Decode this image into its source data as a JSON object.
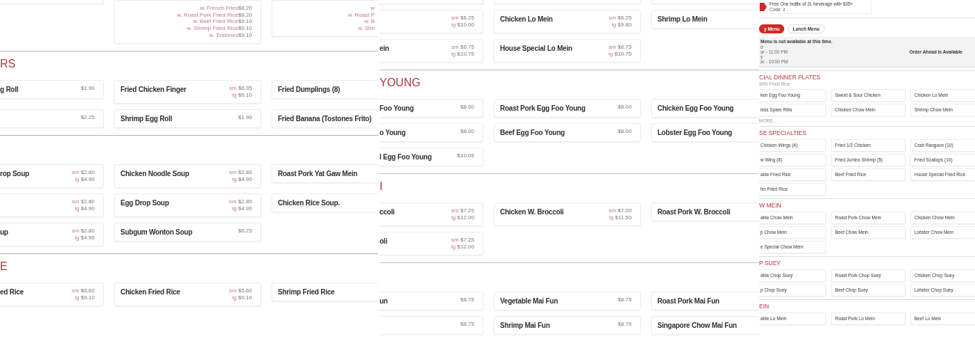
{
  "panels": [
    {
      "sections": [
        {
          "rows": [
            [
              {},
              {
                "options": [
                  {
                    "label": "w. French Fries",
                    "amount": "$8.20"
                  },
                  {
                    "label": "w. Roast Pork Fried Rice",
                    "amount": "$8.20"
                  },
                  {
                    "label": "w. Beef Fried Rice",
                    "amount": "$9.10"
                  },
                  {
                    "label": "w. Shrimp Fried Rice",
                    "amount": "$9.10"
                  },
                  {
                    "label": "w. Tostones",
                    "amount": "$9.10"
                  }
                ]
              },
              {
                "options": [
                  {
                    "label": "w"
                  },
                  {
                    "label": "w. Roast P"
                  },
                  {
                    "label": "w. B"
                  },
                  {
                    "label": "w. Shri"
                  }
                ]
              }
            ]
          ]
        },
        {
          "heading": "RS",
          "rows": [
            [
              {
                "name": "g Roll",
                "price": "$1.90"
              },
              {
                "name": "Fried Chicken Finger",
                "prices": [
                  {
                    "size": "sm",
                    "amount": "$6.35"
                  },
                  {
                    "size": "lg",
                    "amount": "$9.10"
                  }
                ]
              },
              {
                "name": "Fried Dumplings (8)"
              }
            ],
            [
              {
                "price": "$2.25"
              },
              {
                "name": "Shrimp Egg Roll",
                "price": "$1.90"
              },
              {
                "name": "Fried Banana (Tostones Frito)"
              }
            ]
          ]
        },
        {
          "rows": [
            [
              {
                "name": "rop Soup",
                "prices": [
                  {
                    "size": "sm",
                    "amount": "$2.80"
                  },
                  {
                    "size": "lg",
                    "amount": "$4.90"
                  }
                ]
              },
              {
                "name": "Chicken Noodle Soup",
                "prices": [
                  {
                    "size": "sm",
                    "amount": "$2.80"
                  },
                  {
                    "size": "lg",
                    "amount": "$4.90"
                  }
                ]
              },
              {
                "name": "Roast Pork Yat Gaw Mein"
              }
            ],
            [
              {
                "prices": [
                  {
                    "size": "sm",
                    "amount": "$2.80"
                  },
                  {
                    "size": "lg",
                    "amount": "$4.90"
                  }
                ]
              },
              {
                "name": "Egg Drop Soup",
                "prices": [
                  {
                    "size": "sm",
                    "amount": "$2.80"
                  },
                  {
                    "size": "lg",
                    "amount": "$4.90"
                  }
                ]
              },
              {
                "name": "Chicken Rice Soup."
              }
            ],
            [
              {
                "name": "up",
                "prices": [
                  {
                    "size": "sm",
                    "amount": "$2.80"
                  },
                  {
                    "size": "lg",
                    "amount": "$4.90"
                  }
                ]
              },
              {
                "name": "Subgum Wonton Soup",
                "price": "$6.25"
              }
            ]
          ]
        },
        {
          "heading": "E",
          "rows": [
            [
              {
                "name": "ed Rice",
                "prices": [
                  {
                    "size": "sm",
                    "amount": "$5.60"
                  },
                  {
                    "size": "lg",
                    "amount": "$9.10"
                  }
                ]
              },
              {
                "name": "Chicken Fried Rice",
                "prices": [
                  {
                    "size": "sm",
                    "amount": "$5.60"
                  },
                  {
                    "size": "lg",
                    "amount": "$9.10"
                  }
                ]
              },
              {
                "name": "Shrimp Fried Rice"
              }
            ]
          ]
        }
      ]
    },
    {
      "sections": [
        {
          "rows": [
            [
              {},
              {},
              {}
            ],
            [
              {
                "prices": [
                  {
                    "size": "sm",
                    "amount": "$6.25"
                  },
                  {
                    "size": "lg",
                    "amount": "$10.00"
                  }
                ]
              },
              {
                "name": "Chicken Lo Mein",
                "prices": [
                  {
                    "size": "sm",
                    "amount": "$6.25"
                  },
                  {
                    "size": "lg",
                    "amount": "$9.80"
                  }
                ]
              },
              {
                "name": "Shrimp Lo Mein"
              }
            ],
            [
              {
                "name": "ein",
                "prices": [
                  {
                    "size": "sm",
                    "amount": "$6.75"
                  },
                  {
                    "size": "lg",
                    "amount": "$10.75"
                  }
                ]
              },
              {
                "name": "House Special Lo Mein",
                "prices": [
                  {
                    "size": "sm",
                    "amount": "$6.75"
                  },
                  {
                    "size": "lg",
                    "amount": "$10.75"
                  }
                ]
              }
            ]
          ]
        },
        {
          "heading": "YOUNG",
          "rows": [
            [
              {
                "name": "Foo Young",
                "price": "$8.00"
              },
              {
                "name": "Roast Pork Egg Foo Young",
                "price": "$8.00"
              },
              {
                "name": "Chicken Egg Foo Young"
              }
            ],
            [
              {
                "name": "o Young",
                "price": "$8.00"
              },
              {
                "name": "Beef Egg Foo Young",
                "price": "$8.00"
              },
              {
                "name": "Lobster Egg Foo Young"
              }
            ],
            [
              {
                "name": "l Egg Foo Young",
                "price": "$10.05"
              }
            ]
          ]
        },
        {
          "heading": "I",
          "rows": [
            [
              {
                "name": "ccoli",
                "prices": [
                  {
                    "size": "sm",
                    "amount": "$7.25"
                  },
                  {
                    "size": "lg",
                    "amount": "$12.00"
                  }
                ]
              },
              {
                "name": "Chicken W. Broccoli",
                "prices": [
                  {
                    "size": "sm",
                    "amount": "$7.00"
                  },
                  {
                    "size": "lg",
                    "amount": "$11.50"
                  }
                ]
              },
              {
                "name": "Roast Pork W. Broccoli"
              }
            ],
            [
              {
                "name": "oli",
                "prices": [
                  {
                    "size": "sm",
                    "amount": "$7.25"
                  },
                  {
                    "size": "lg",
                    "amount": "$12.00"
                  }
                ]
              }
            ]
          ]
        },
        {
          "rows": [
            [
              {
                "name": "un",
                "price": "$8.75"
              },
              {
                "name": "Vegetable Mai Fun",
                "price": "$8.75"
              },
              {
                "name": "Roast Pork Mai Fun"
              }
            ],
            [
              {
                "price": "$8.75"
              },
              {
                "name": "Shrimp Mai Fun",
                "price": "$8.75"
              },
              {
                "name": "Singapore Chow Mai Fun"
              }
            ]
          ]
        }
      ]
    },
    {
      "header": {
        "promo": [
          "Free One bottle of 2L beverage with $35+",
          "Code: z"
        ],
        "menus": [
          {
            "label": "y Menu",
            "selected": true
          },
          {
            "label": "Lunch Menu",
            "selected": false
          }
        ],
        "notice": {
          "title": "Menu is not available at this time.",
          "lines": [
            "d",
            "ar - 11:00 PM",
            "y",
            "ar - 10:00 PM"
          ],
          "status": "Order Ahead Is Available"
        }
      },
      "sections": [
        {
          "heading": "CIAL DINNER PLATES",
          "subtitle": "With Fried Rice",
          "more": "MORE...",
          "rows": [
            [
              {
                "name": "ken Egg Foo Young"
              },
              {
                "name": "Sweet & Sour Chicken"
              },
              {
                "name": "Chicken Lo Mein"
              }
            ],
            [
              {
                "name": "less Spare Ribs"
              },
              {
                "name": "Chicken Chow Mein"
              },
              {
                "name": "Shrimp Chow Mein"
              }
            ]
          ]
        },
        {
          "heading": "SE SPECIALTIES",
          "rows": [
            [
              {
                "name": "Chicken Wings (4)"
              },
              {
                "name": "Fried 1/2 Chicken"
              },
              {
                "name": "Crab Rangoon (10)"
              }
            ],
            [
              {
                "name": "w Wing (8)"
              },
              {
                "name": "Fried Jumbo Shrimp (5)"
              },
              {
                "name": "Fried Scallops (10)"
              }
            ],
            [
              {
                "name": "able Fried Rice"
              },
              {
                "name": "Beef Fried Rice"
              },
              {
                "name": "House Special Fried Rice"
              }
            ],
            [
              {
                "name": "ter Fried Rice"
              }
            ]
          ]
        },
        {
          "heading": "W MEIN",
          "rows": [
            [
              {
                "name": "able Chow Mein"
              },
              {
                "name": "Roast Pork Chow Mein"
              },
              {
                "name": "Chicken Chow Mein"
              }
            ],
            [
              {
                "name": "p Chow Mein"
              },
              {
                "name": "Beef Chow Mein"
              },
              {
                "name": "Lobster Chow Mein"
              }
            ],
            [
              {
                "name": "e Special Chow Mein"
              }
            ]
          ]
        },
        {
          "heading": "P SUEY",
          "rows": [
            [
              {
                "name": "able Chop Suey"
              },
              {
                "name": "Roast Pork Chop Suey"
              },
              {
                "name": "Chicken Chop Suey"
              }
            ],
            [
              {
                "name": "p Chop Suey"
              },
              {
                "name": "Beef Chop Suey"
              },
              {
                "name": "Lobster Chop Suey"
              }
            ]
          ]
        },
        {
          "heading": "EIN",
          "rows": [
            [
              {
                "name": "able Lo Mein"
              },
              {
                "name": "Roast Pork Lo Mein"
              },
              {
                "name": "Beef Lo Mein"
              }
            ]
          ]
        }
      ]
    }
  ]
}
